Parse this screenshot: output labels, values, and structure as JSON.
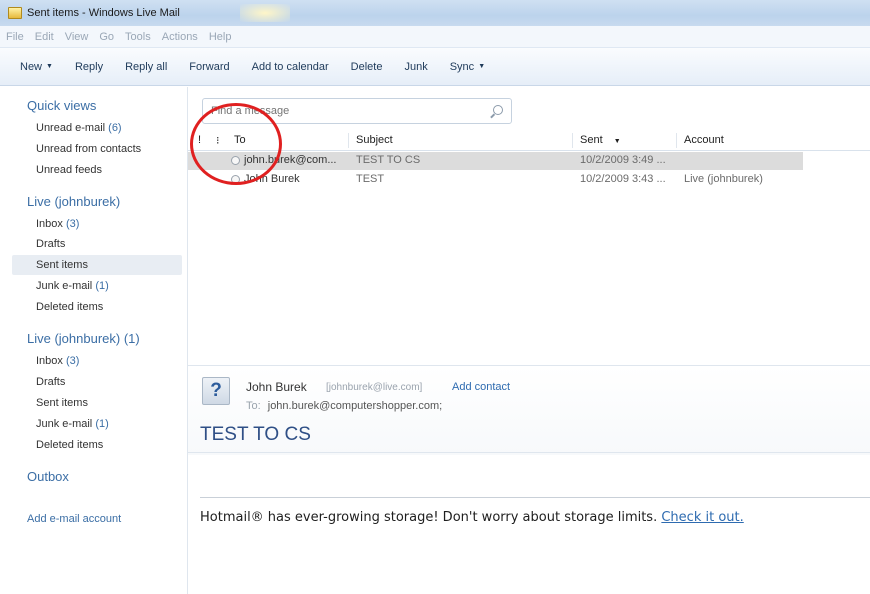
{
  "window": {
    "title": "Sent items - Windows Live Mail"
  },
  "menu": [
    "File",
    "Edit",
    "View",
    "Go",
    "Tools",
    "Actions",
    "Help"
  ],
  "toolbar": {
    "new": "New",
    "reply": "Reply",
    "reply_all": "Reply all",
    "forward": "Forward",
    "add_to_calendar": "Add to calendar",
    "delete": "Delete",
    "junk": "Junk",
    "sync": "Sync"
  },
  "sidebar": {
    "quick_views": {
      "title": "Quick views",
      "items": [
        {
          "label": "Unread e-mail",
          "count": "(6)"
        },
        {
          "label": "Unread from contacts",
          "count": ""
        },
        {
          "label": "Unread feeds",
          "count": ""
        }
      ]
    },
    "account1": {
      "title": "Live (johnburek)",
      "items": [
        {
          "label": "Inbox",
          "count": "(3)"
        },
        {
          "label": "Drafts",
          "count": ""
        },
        {
          "label": "Sent items",
          "count": ""
        },
        {
          "label": "Junk e-mail",
          "count": "(1)"
        },
        {
          "label": "Deleted items",
          "count": ""
        }
      ]
    },
    "account2": {
      "title": "Live (johnburek) (1)",
      "items": [
        {
          "label": "Inbox",
          "count": "(3)"
        },
        {
          "label": "Drafts",
          "count": ""
        },
        {
          "label": "Sent items",
          "count": ""
        },
        {
          "label": "Junk e-mail",
          "count": "(1)"
        },
        {
          "label": "Deleted items",
          "count": ""
        }
      ]
    },
    "outbox": "Outbox",
    "add_account": "Add e-mail account"
  },
  "search": {
    "placeholder": "Find a message"
  },
  "list": {
    "columns": {
      "to": "To",
      "subject": "Subject",
      "sent": "Sent",
      "account": "Account"
    },
    "rows": [
      {
        "to": "john.burek@com...",
        "subject": "TEST TO CS",
        "sent": "10/2/2009 3:49 ...",
        "account": ""
      },
      {
        "to": "John Burek",
        "subject": "TEST",
        "sent": "10/2/2009 3:43 ...",
        "account": "Live (johnburek)"
      }
    ]
  },
  "message": {
    "sender_name": "John Burek",
    "sender_email": "[johnburek@live.com]",
    "add_contact": "Add contact",
    "to_label": "To:",
    "to_value": "john.burek@computershopper.com;",
    "subject": "TEST TO CS",
    "body_text": "Hotmail® has ever-growing storage! Don't worry about storage limits.",
    "body_link": "Check it out."
  }
}
